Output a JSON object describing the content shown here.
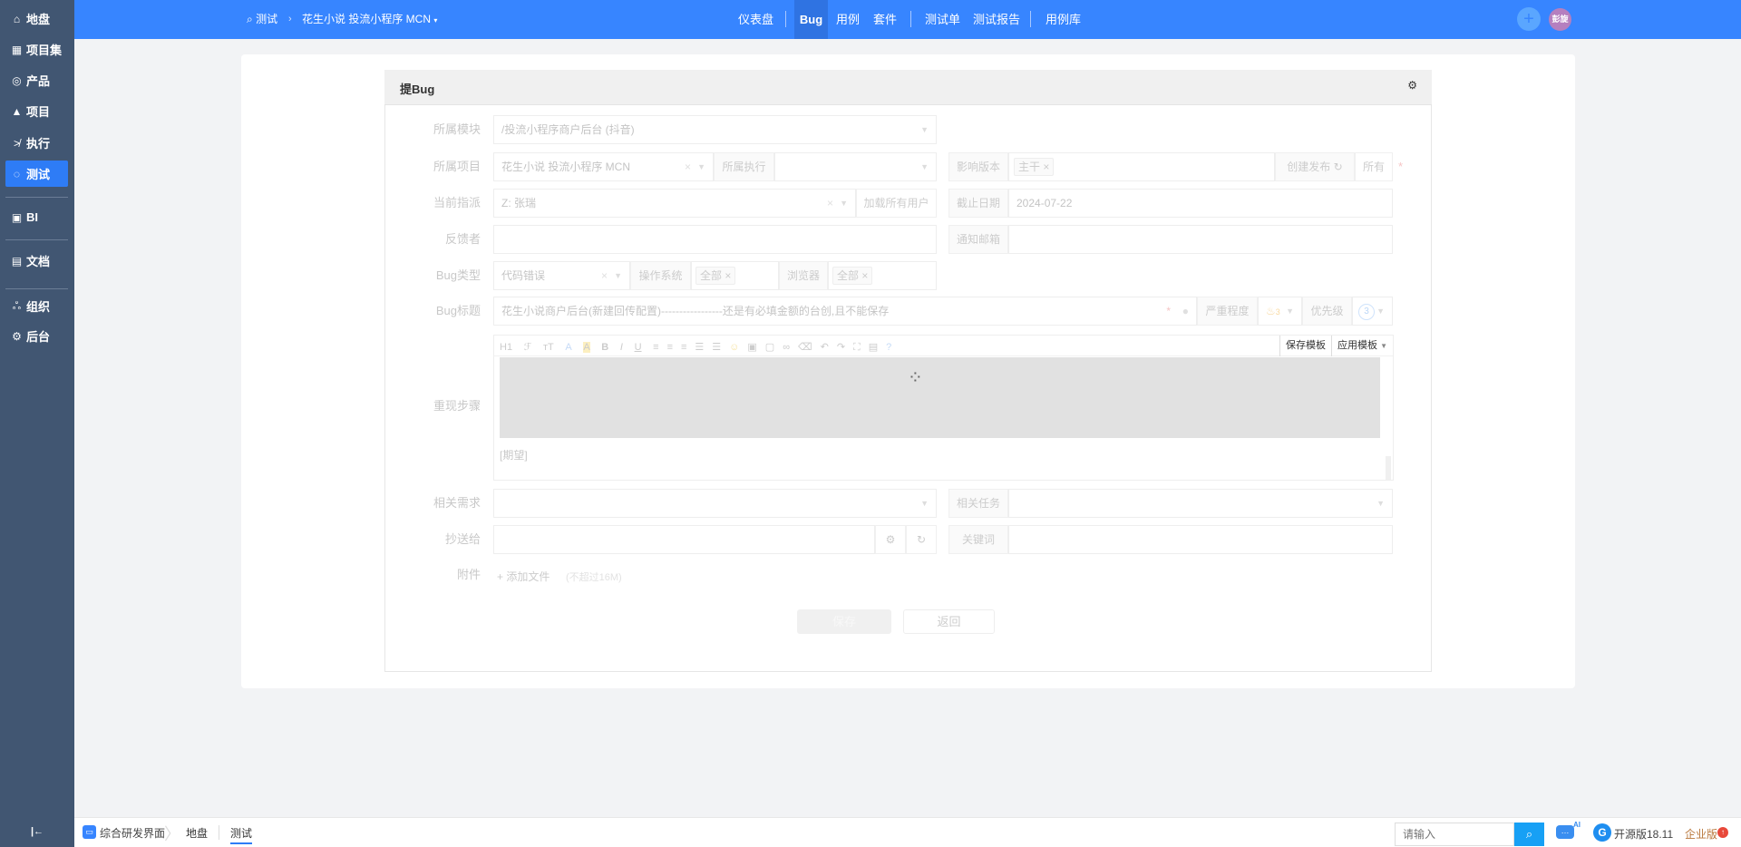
{
  "sidebar": {
    "items": [
      {
        "label": "地盘",
        "icon": "home-icon"
      },
      {
        "label": "项目集",
        "icon": "grid-icon"
      },
      {
        "label": "产品",
        "icon": "bulb-icon"
      },
      {
        "label": "项目",
        "icon": "rocket-icon"
      },
      {
        "label": "执行",
        "icon": "run-icon"
      },
      {
        "label": "测试",
        "icon": "test-icon"
      },
      {
        "label": "BI",
        "icon": "chart-board-icon"
      },
      {
        "label": "文档",
        "icon": "doc-icon"
      },
      {
        "label": "组织",
        "icon": "people-icon"
      },
      {
        "label": "后台",
        "icon": "gear-icon"
      }
    ]
  },
  "topbar": {
    "breadcrumb_module": "测试",
    "breadcrumb_product": "花生小说 投流小程序 MCN",
    "nav": [
      "仪表盘",
      "Bug",
      "用例",
      "套件",
      "测试单",
      "测试报告",
      "用例库"
    ],
    "avatar": "彭旋"
  },
  "panel": {
    "title": "提Bug"
  },
  "form": {
    "module_label": "所属模块",
    "module_value": "/投流小程序商户后台 (抖音)",
    "project_label": "所属项目",
    "project_value": "花生小说 投流小程序 MCN",
    "execution_label": "所属执行",
    "build_label": "影响版本",
    "build_tag": "主干",
    "create_release": "创建发布",
    "all": "所有",
    "assign_label": "当前指派",
    "assign_value": "Z: 张瑞",
    "load_users": "加载所有用户",
    "deadline_label": "截止日期",
    "deadline_value": "2024-07-22",
    "feedback_label": "反馈者",
    "notify_label": "通知邮箱",
    "type_label": "Bug类型",
    "type_value": "代码错误",
    "os_label": "操作系统",
    "os_tag": "全部",
    "browser_label": "浏览器",
    "browser_tag": "全部",
    "title_label": "Bug标题",
    "title_value": "花生小说商户后台(新建回传配置)-----------------还是有必填金额的台创,且不能保存",
    "severity_label": "严重程度",
    "severity_value": "3",
    "priority_label": "优先级",
    "priority_value": "3",
    "steps_label": "重现步骤",
    "steps_expect": "[期望]",
    "save_template": "保存模板",
    "apply_template": "应用模板",
    "toolbar": [
      "H1",
      "ℱ",
      "тT",
      "A",
      "A",
      "B",
      "I",
      "U"
    ],
    "story_label": "相关需求",
    "task_label": "相关任务",
    "cc_label": "抄送给",
    "keywords_label": "关键词",
    "files_label": "附件",
    "add_file": "添加文件",
    "file_limit": "(不超过16M)",
    "save": "保存",
    "back": "返回"
  },
  "bottombar": {
    "app": "综合研发界面",
    "crumbs": [
      "地盘",
      "测试"
    ],
    "search_placeholder": "请输入",
    "version": "开源版18.11",
    "enterprise": "企业版",
    "ai": "AI"
  }
}
